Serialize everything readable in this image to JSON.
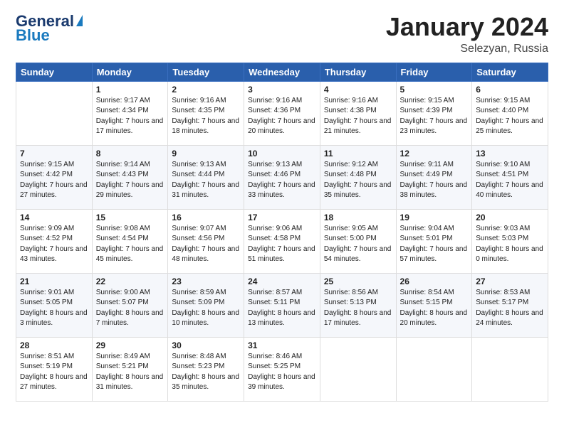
{
  "logo": {
    "line1": "General",
    "line2": "Blue"
  },
  "title": "January 2024",
  "subtitle": "Selezyan, Russia",
  "weekdays": [
    "Sunday",
    "Monday",
    "Tuesday",
    "Wednesday",
    "Thursday",
    "Friday",
    "Saturday"
  ],
  "weeks": [
    [
      {
        "day": "",
        "sunrise": "",
        "sunset": "",
        "daylight": ""
      },
      {
        "day": "1",
        "sunrise": "Sunrise: 9:17 AM",
        "sunset": "Sunset: 4:34 PM",
        "daylight": "Daylight: 7 hours and 17 minutes."
      },
      {
        "day": "2",
        "sunrise": "Sunrise: 9:16 AM",
        "sunset": "Sunset: 4:35 PM",
        "daylight": "Daylight: 7 hours and 18 minutes."
      },
      {
        "day": "3",
        "sunrise": "Sunrise: 9:16 AM",
        "sunset": "Sunset: 4:36 PM",
        "daylight": "Daylight: 7 hours and 20 minutes."
      },
      {
        "day": "4",
        "sunrise": "Sunrise: 9:16 AM",
        "sunset": "Sunset: 4:38 PM",
        "daylight": "Daylight: 7 hours and 21 minutes."
      },
      {
        "day": "5",
        "sunrise": "Sunrise: 9:15 AM",
        "sunset": "Sunset: 4:39 PM",
        "daylight": "Daylight: 7 hours and 23 minutes."
      },
      {
        "day": "6",
        "sunrise": "Sunrise: 9:15 AM",
        "sunset": "Sunset: 4:40 PM",
        "daylight": "Daylight: 7 hours and 25 minutes."
      }
    ],
    [
      {
        "day": "7",
        "sunrise": "Sunrise: 9:15 AM",
        "sunset": "Sunset: 4:42 PM",
        "daylight": "Daylight: 7 hours and 27 minutes."
      },
      {
        "day": "8",
        "sunrise": "Sunrise: 9:14 AM",
        "sunset": "Sunset: 4:43 PM",
        "daylight": "Daylight: 7 hours and 29 minutes."
      },
      {
        "day": "9",
        "sunrise": "Sunrise: 9:13 AM",
        "sunset": "Sunset: 4:44 PM",
        "daylight": "Daylight: 7 hours and 31 minutes."
      },
      {
        "day": "10",
        "sunrise": "Sunrise: 9:13 AM",
        "sunset": "Sunset: 4:46 PM",
        "daylight": "Daylight: 7 hours and 33 minutes."
      },
      {
        "day": "11",
        "sunrise": "Sunrise: 9:12 AM",
        "sunset": "Sunset: 4:48 PM",
        "daylight": "Daylight: 7 hours and 35 minutes."
      },
      {
        "day": "12",
        "sunrise": "Sunrise: 9:11 AM",
        "sunset": "Sunset: 4:49 PM",
        "daylight": "Daylight: 7 hours and 38 minutes."
      },
      {
        "day": "13",
        "sunrise": "Sunrise: 9:10 AM",
        "sunset": "Sunset: 4:51 PM",
        "daylight": "Daylight: 7 hours and 40 minutes."
      }
    ],
    [
      {
        "day": "14",
        "sunrise": "Sunrise: 9:09 AM",
        "sunset": "Sunset: 4:52 PM",
        "daylight": "Daylight: 7 hours and 43 minutes."
      },
      {
        "day": "15",
        "sunrise": "Sunrise: 9:08 AM",
        "sunset": "Sunset: 4:54 PM",
        "daylight": "Daylight: 7 hours and 45 minutes."
      },
      {
        "day": "16",
        "sunrise": "Sunrise: 9:07 AM",
        "sunset": "Sunset: 4:56 PM",
        "daylight": "Daylight: 7 hours and 48 minutes."
      },
      {
        "day": "17",
        "sunrise": "Sunrise: 9:06 AM",
        "sunset": "Sunset: 4:58 PM",
        "daylight": "Daylight: 7 hours and 51 minutes."
      },
      {
        "day": "18",
        "sunrise": "Sunrise: 9:05 AM",
        "sunset": "Sunset: 5:00 PM",
        "daylight": "Daylight: 7 hours and 54 minutes."
      },
      {
        "day": "19",
        "sunrise": "Sunrise: 9:04 AM",
        "sunset": "Sunset: 5:01 PM",
        "daylight": "Daylight: 7 hours and 57 minutes."
      },
      {
        "day": "20",
        "sunrise": "Sunrise: 9:03 AM",
        "sunset": "Sunset: 5:03 PM",
        "daylight": "Daylight: 8 hours and 0 minutes."
      }
    ],
    [
      {
        "day": "21",
        "sunrise": "Sunrise: 9:01 AM",
        "sunset": "Sunset: 5:05 PM",
        "daylight": "Daylight: 8 hours and 3 minutes."
      },
      {
        "day": "22",
        "sunrise": "Sunrise: 9:00 AM",
        "sunset": "Sunset: 5:07 PM",
        "daylight": "Daylight: 8 hours and 7 minutes."
      },
      {
        "day": "23",
        "sunrise": "Sunrise: 8:59 AM",
        "sunset": "Sunset: 5:09 PM",
        "daylight": "Daylight: 8 hours and 10 minutes."
      },
      {
        "day": "24",
        "sunrise": "Sunrise: 8:57 AM",
        "sunset": "Sunset: 5:11 PM",
        "daylight": "Daylight: 8 hours and 13 minutes."
      },
      {
        "day": "25",
        "sunrise": "Sunrise: 8:56 AM",
        "sunset": "Sunset: 5:13 PM",
        "daylight": "Daylight: 8 hours and 17 minutes."
      },
      {
        "day": "26",
        "sunrise": "Sunrise: 8:54 AM",
        "sunset": "Sunset: 5:15 PM",
        "daylight": "Daylight: 8 hours and 20 minutes."
      },
      {
        "day": "27",
        "sunrise": "Sunrise: 8:53 AM",
        "sunset": "Sunset: 5:17 PM",
        "daylight": "Daylight: 8 hours and 24 minutes."
      }
    ],
    [
      {
        "day": "28",
        "sunrise": "Sunrise: 8:51 AM",
        "sunset": "Sunset: 5:19 PM",
        "daylight": "Daylight: 8 hours and 27 minutes."
      },
      {
        "day": "29",
        "sunrise": "Sunrise: 8:49 AM",
        "sunset": "Sunset: 5:21 PM",
        "daylight": "Daylight: 8 hours and 31 minutes."
      },
      {
        "day": "30",
        "sunrise": "Sunrise: 8:48 AM",
        "sunset": "Sunset: 5:23 PM",
        "daylight": "Daylight: 8 hours and 35 minutes."
      },
      {
        "day": "31",
        "sunrise": "Sunrise: 8:46 AM",
        "sunset": "Sunset: 5:25 PM",
        "daylight": "Daylight: 8 hours and 39 minutes."
      },
      {
        "day": "",
        "sunrise": "",
        "sunset": "",
        "daylight": ""
      },
      {
        "day": "",
        "sunrise": "",
        "sunset": "",
        "daylight": ""
      },
      {
        "day": "",
        "sunrise": "",
        "sunset": "",
        "daylight": ""
      }
    ]
  ]
}
